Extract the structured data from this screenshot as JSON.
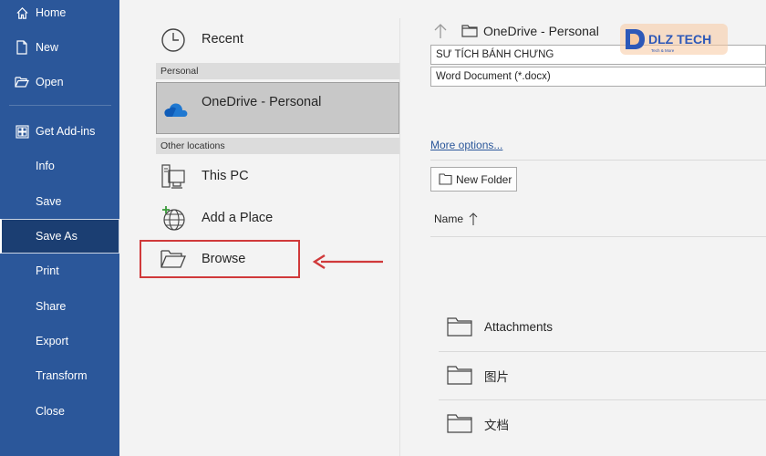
{
  "nav": {
    "items": [
      {
        "label": "Home",
        "icon": "home-icon"
      },
      {
        "label": "New",
        "icon": "new-document-icon"
      },
      {
        "label": "Open",
        "icon": "open-folder-icon"
      },
      {
        "label": "Get Add-ins",
        "icon": "add-ins-grid-icon"
      },
      {
        "label": "Info"
      },
      {
        "label": "Save"
      },
      {
        "label": "Save As",
        "selected": true
      },
      {
        "label": "Print"
      },
      {
        "label": "Share"
      },
      {
        "label": "Export"
      },
      {
        "label": "Transform"
      },
      {
        "label": "Close"
      }
    ],
    "bg_color": "#2b579a",
    "selected_color": "#1b3e72"
  },
  "locations": {
    "recent": {
      "label": "Recent",
      "icon": "clock-icon"
    },
    "personal_header": "Personal",
    "onedrive": {
      "label": "OneDrive - Personal",
      "icon": "cloud-icon"
    },
    "other_header": "Other locations",
    "this_pc": {
      "label": "This PC",
      "icon": "computer-icon"
    },
    "add_place": {
      "label": "Add a Place",
      "icon": "globe-plus-icon"
    },
    "browse": {
      "label": "Browse",
      "icon": "folder-open-icon"
    }
  },
  "annotation": {
    "highlight_color": "#d0393a",
    "arrow_icon": "arrow-left-icon"
  },
  "save_panel": {
    "path": "OneDrive - Personal",
    "filename": "SƯ TÍCH BÁNH CHƯNG",
    "filetype": "Word Document (*.docx)",
    "more_options": "More options...",
    "new_folder": "New Folder",
    "name_column": "Name",
    "files": [
      {
        "name": "Attachments"
      },
      {
        "name": "图片"
      },
      {
        "name": "文档"
      }
    ]
  },
  "logo": {
    "text": "DLZ TECH",
    "tagline": "Tech & More"
  }
}
